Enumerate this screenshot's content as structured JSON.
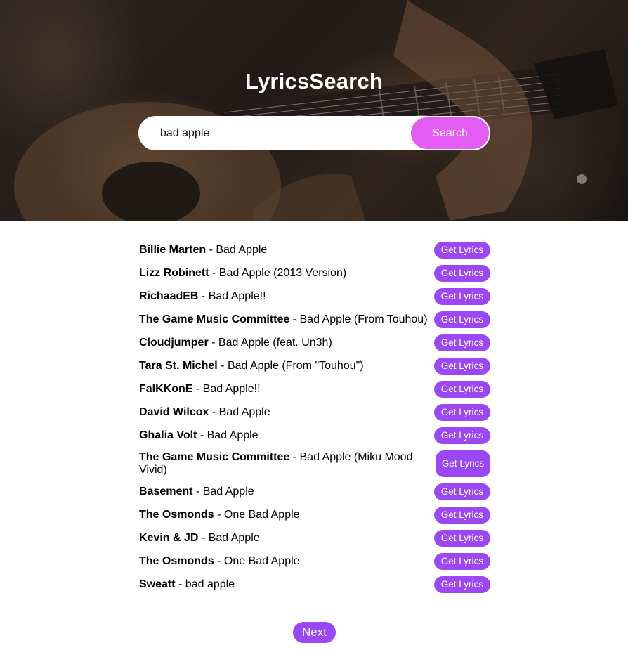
{
  "header": {
    "title": "LyricsSearch",
    "background_image": "guitar-photo"
  },
  "search": {
    "value": "bad apple",
    "button_label": "Search"
  },
  "results": [
    {
      "artist": "Billie Marten",
      "separator": " - ",
      "song": "Bad Apple",
      "button_label": "Get Lyrics"
    },
    {
      "artist": "Lizz Robinett",
      "separator": " - ",
      "song": "Bad Apple (2013 Version)",
      "button_label": "Get Lyrics"
    },
    {
      "artist": "RichaadEB",
      "separator": " - ",
      "song": "Bad Apple!!",
      "button_label": "Get Lyrics"
    },
    {
      "artist": "The Game Music Committee",
      "separator": " - ",
      "song": "Bad Apple (From Touhou)",
      "button_label": "Get Lyrics"
    },
    {
      "artist": "Cloudjumper",
      "separator": " - ",
      "song": "Bad Apple (feat. Un3h)",
      "button_label": "Get Lyrics"
    },
    {
      "artist": "Tara St. Michel",
      "separator": " - ",
      "song": "Bad Apple (From \"Touhou\")",
      "button_label": "Get Lyrics"
    },
    {
      "artist": "FalKKonE",
      "separator": " - ",
      "song": "Bad Apple!!",
      "button_label": "Get Lyrics"
    },
    {
      "artist": "David Wilcox",
      "separator": " - ",
      "song": "Bad Apple",
      "button_label": "Get Lyrics"
    },
    {
      "artist": "Ghalia Volt",
      "separator": " - ",
      "song": "Bad Apple",
      "button_label": "Get Lyrics"
    },
    {
      "artist": "The Game Music Committee",
      "separator": " - ",
      "song": "Bad Apple (Miku Mood Vivid)",
      "button_label": "Get Lyrics"
    },
    {
      "artist": "Basement",
      "separator": " - ",
      "song": "Bad Apple",
      "button_label": "Get Lyrics"
    },
    {
      "artist": "The Osmonds",
      "separator": " - ",
      "song": "One Bad Apple",
      "button_label": "Get Lyrics"
    },
    {
      "artist": "Kevin & JD",
      "separator": " - ",
      "song": "Bad Apple",
      "button_label": "Get Lyrics"
    },
    {
      "artist": "The Osmonds",
      "separator": " - ",
      "song": "One Bad Apple",
      "button_label": "Get Lyrics"
    },
    {
      "artist": "Sweatt",
      "separator": " - ",
      "song": "bad apple",
      "button_label": "Get Lyrics"
    }
  ],
  "pagination": {
    "next_label": "Next"
  },
  "colors": {
    "search_button": "#e35cf4",
    "lyrics_button": "#9b47f3",
    "next_button": "#9b47f3"
  }
}
